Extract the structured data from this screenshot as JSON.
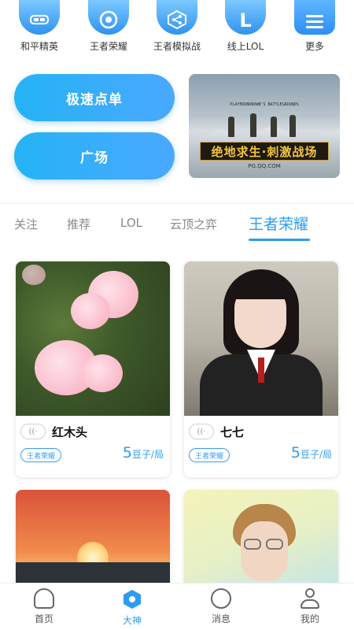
{
  "categories": [
    {
      "label": "和平精英",
      "icon": "game-helmet-icon"
    },
    {
      "label": "王者荣耀",
      "icon": "game-emblem-icon"
    },
    {
      "label": "王者模拟战",
      "icon": "share-nodes-icon"
    },
    {
      "label": "线上LOL",
      "icon": "letter-l-icon",
      "glyph": "L"
    },
    {
      "label": "更多",
      "icon": "menu-lines-icon"
    }
  ],
  "promo": {
    "quick_order": "极速点单",
    "plaza": "广场",
    "banner": {
      "subtitle": "PLAYERUNKNOWN'S BATTLEGROUNDS",
      "title": "绝地求生·刺激战场",
      "site": "PG.QQ.COM"
    }
  },
  "tabs": {
    "items": [
      "关注",
      "推荐",
      "LOL",
      "云顶之弈",
      "王者荣耀"
    ],
    "active": "王者荣耀"
  },
  "cards": [
    {
      "name": "红木头",
      "tag": "王者荣耀",
      "price": "5",
      "unit": "豆子/局",
      "photo": "flower-photo"
    },
    {
      "name": "七七",
      "tag": "王者荣耀",
      "price": "5",
      "unit": "豆子/局",
      "photo": "girl-photo"
    },
    {
      "photo": "sunset-photo"
    },
    {
      "photo": "boy-photo"
    }
  ],
  "bottom_nav": [
    {
      "label": "首页",
      "icon": "home-icon"
    },
    {
      "label": "大神",
      "icon": "hexagon-icon",
      "active": true
    },
    {
      "label": "消息",
      "icon": "chat-bubble-icon"
    },
    {
      "label": "我的",
      "icon": "person-icon"
    }
  ],
  "colors": {
    "accent": "#2d9cf0",
    "button": "#25b3f5"
  }
}
